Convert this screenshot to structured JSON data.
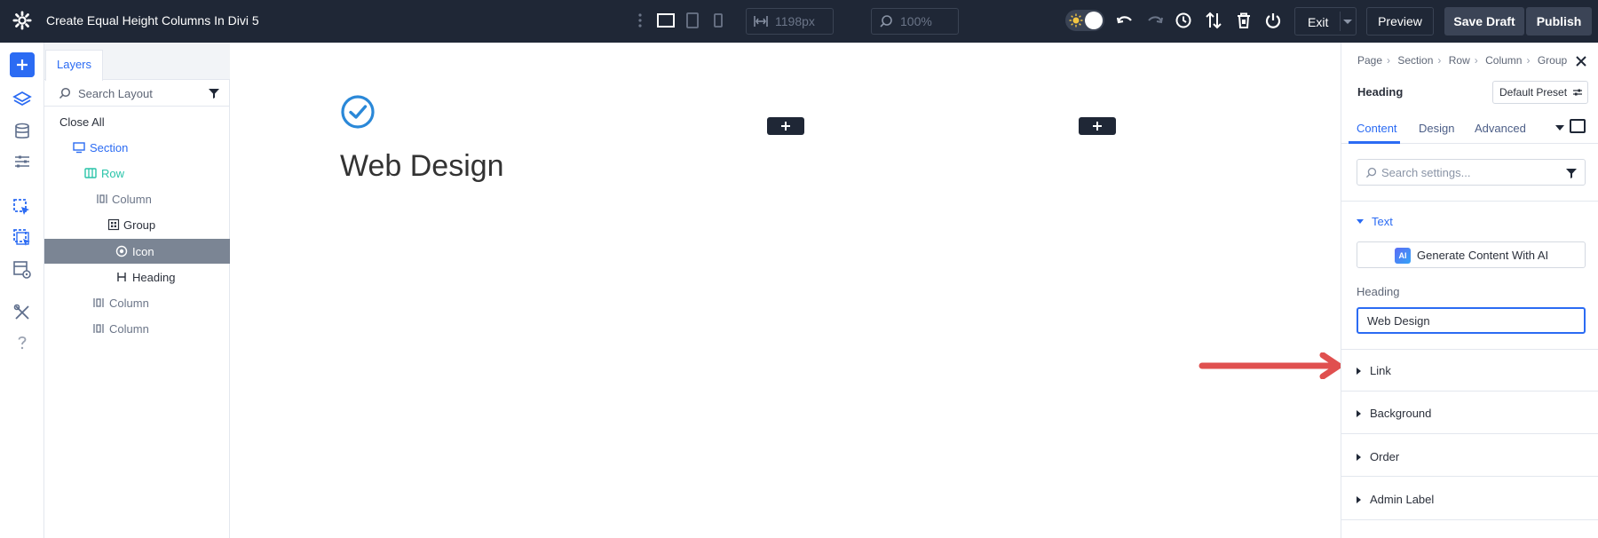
{
  "topbar": {
    "title": "Create Equal Height Columns In Divi 5",
    "width_field": "1198px",
    "zoom_field": "100%",
    "exit_label": "Exit",
    "preview_label": "Preview",
    "save_draft_label": "Save Draft",
    "publish_label": "Publish"
  },
  "layers": {
    "tab_label": "Layers",
    "search_placeholder": "Search Layout",
    "close_all": "Close All",
    "items": [
      {
        "label": "Section",
        "type": "section",
        "color": "#2b6bf3"
      },
      {
        "label": "Row",
        "type": "row",
        "color": "#29c4a9"
      },
      {
        "label": "Column",
        "type": "column",
        "color": "#6b7588"
      },
      {
        "label": "Group",
        "type": "group",
        "color": "#2b303b"
      },
      {
        "label": "Icon",
        "type": "icon",
        "color": "#ffffff",
        "selected": true
      },
      {
        "label": "Heading",
        "type": "heading",
        "color": "#2b303b"
      },
      {
        "label": "Column",
        "type": "column",
        "color": "#6b7588"
      },
      {
        "label": "Column",
        "type": "column",
        "color": "#6b7588"
      }
    ]
  },
  "canvas": {
    "heading_text": "Web Design"
  },
  "settings": {
    "breadcrumb": [
      "Page",
      "Section",
      "Row",
      "Column",
      "Group"
    ],
    "module_name": "Heading",
    "preset_label": "Default Preset",
    "tabs": [
      "Content",
      "Design",
      "Advanced"
    ],
    "search_placeholder": "Search settings...",
    "group_text_label": "Text",
    "ai_button_label": "Generate Content With AI",
    "ai_badge": "AI",
    "heading_field_label": "Heading",
    "heading_field_value": "Web Design",
    "groups": [
      "Link",
      "Background",
      "Order",
      "Admin Label"
    ]
  },
  "colors": {
    "topbar_bg": "#1f2736",
    "accent_blue": "#2b6bf3",
    "row_green": "#29c4a9",
    "arrow_red": "#e0504f",
    "selected_row_bg": "#7b8594"
  }
}
